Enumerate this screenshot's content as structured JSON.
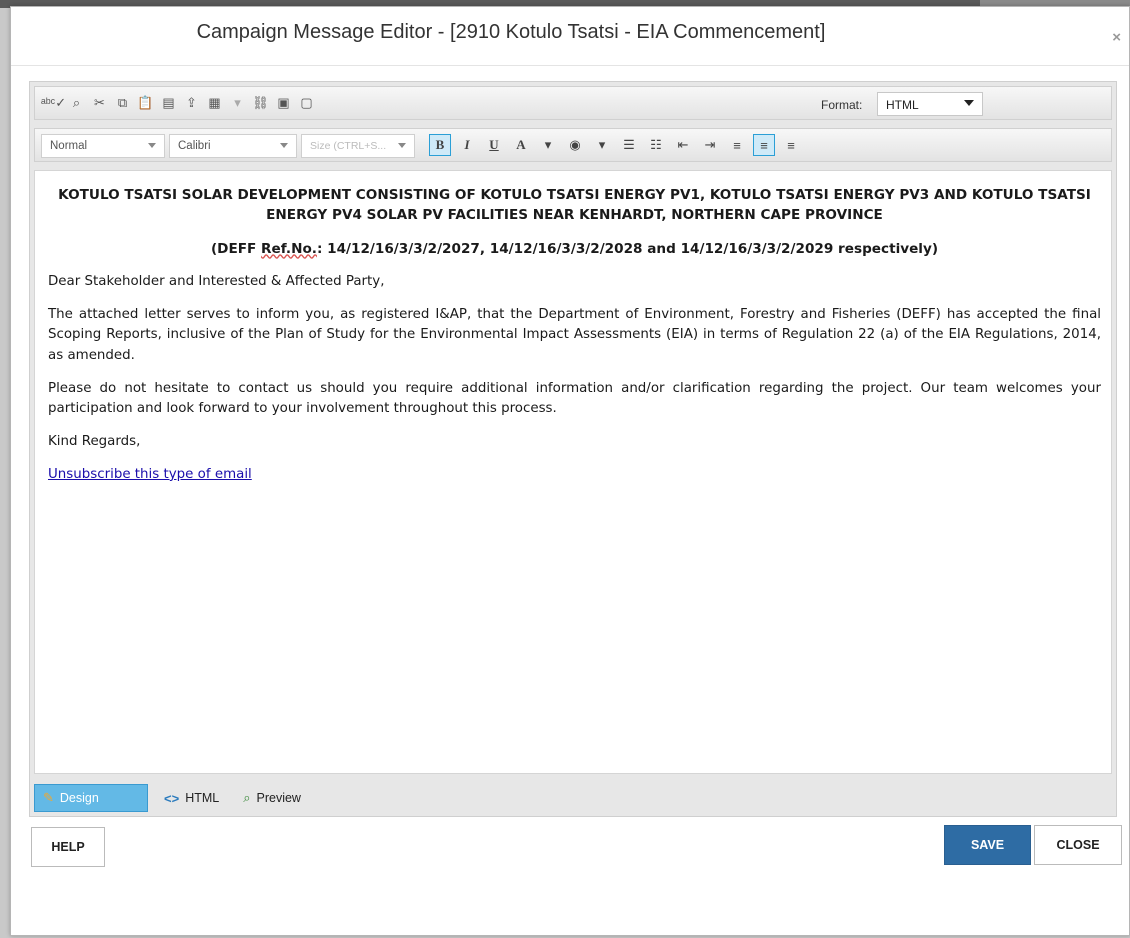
{
  "dialog": {
    "title": "Campaign Message Editor - [2910 Kotulo Tsatsi - EIA Commencement]",
    "close_glyph": "×"
  },
  "toolbar": {
    "row1_icons": [
      {
        "name": "spellcheck-icon",
        "glyph": "ᵃᵇᶜ✓"
      },
      {
        "name": "find-icon",
        "glyph": "⌕"
      },
      {
        "name": "cut-icon",
        "glyph": "✂"
      },
      {
        "name": "copy-icon",
        "glyph": "⧉"
      },
      {
        "name": "paste-icon",
        "glyph": "📋"
      },
      {
        "name": "paste-from-word-icon",
        "glyph": "▤"
      },
      {
        "name": "upload-icon",
        "glyph": "⇪"
      },
      {
        "name": "table-icon",
        "glyph": "▦"
      },
      {
        "name": "dropdown-arrow-icon",
        "glyph": "▾"
      },
      {
        "name": "link-icon",
        "glyph": "⛓"
      },
      {
        "name": "image-icon",
        "glyph": "▣"
      },
      {
        "name": "template-icon",
        "glyph": "▢"
      }
    ],
    "format_label": "Format:",
    "format_value": "HTML",
    "paragraph_style": "Normal",
    "font_family": "Calibri",
    "font_size_placeholder": "Size (CTRL+S...",
    "format_buttons": [
      {
        "name": "bold-button",
        "glyph": "B",
        "active": true,
        "serif": true
      },
      {
        "name": "italic-button",
        "glyph": "I",
        "active": false,
        "serif": true
      },
      {
        "name": "underline-button",
        "glyph": "U",
        "active": false,
        "serif": true
      },
      {
        "name": "font-color-button",
        "glyph": "A",
        "active": false,
        "serif": true
      },
      {
        "name": "font-color-dropdown-icon",
        "glyph": "▾",
        "active": false,
        "serif": false
      },
      {
        "name": "highlight-button",
        "glyph": "◉",
        "active": false,
        "serif": false
      },
      {
        "name": "highlight-dropdown-icon",
        "glyph": "▾",
        "active": false,
        "serif": false
      },
      {
        "name": "ordered-list-button",
        "glyph": "☰",
        "active": false,
        "serif": false
      },
      {
        "name": "bullet-list-button",
        "glyph": "☷",
        "active": false,
        "serif": false
      },
      {
        "name": "outdent-button",
        "glyph": "⇤",
        "active": false,
        "serif": false
      },
      {
        "name": "indent-button",
        "glyph": "⇥",
        "active": false,
        "serif": false
      },
      {
        "name": "align-left-button",
        "glyph": "≡",
        "active": false,
        "serif": false
      },
      {
        "name": "align-center-button",
        "glyph": "≡",
        "active": true,
        "serif": false
      },
      {
        "name": "align-right-button",
        "glyph": "≡",
        "active": false,
        "serif": false
      }
    ]
  },
  "content": {
    "heading": "KOTULO TSATSI SOLAR DEVELOPMENT CONSISTING OF KOTULO TSATSI ENERGY PV1, KOTULO TSATSI ENERGY PV3 AND KOTULO TSATSI ENERGY PV4 SOLAR PV FACILITIES NEAR KENHARDT, NORTHERN CAPE PROVINCE",
    "ref_prefix": "(DEFF ",
    "ref_misspelled": "Ref.No.",
    "ref_suffix": ": 14/12/16/3/3/2/2027, 14/12/16/3/3/2/2028 and 14/12/16/3/3/2/2029 respectively)",
    "greeting": "Dear Stakeholder and Interested & Affected Party,",
    "paragraph1": "The attached letter serves to inform you, as registered I&AP, that the Department of Environment, Forestry and Fisheries (DEFF) has accepted the final Scoping Reports, inclusive of the Plan of Study for the Environmental Impact Assessments (EIA) in terms of Regulation 22 (a) of the EIA Regulations, 2014, as amended.",
    "paragraph2": "Please do not hesitate to contact us should you require additional information and/or clarification regarding the project.  Our team welcomes your participation and look forward to your involvement throughout this process.",
    "closing": "Kind Regards,",
    "unsubscribe_link": "Unsubscribe this type of email"
  },
  "tabs": [
    {
      "label": "Design",
      "name": "tab-design",
      "icon": "✎",
      "icon_name": "pencil-icon",
      "active": true
    },
    {
      "label": "HTML",
      "name": "tab-html",
      "icon": "<>",
      "icon_name": "code-icon",
      "active": false
    },
    {
      "label": "Preview",
      "name": "tab-preview",
      "icon": "⌕",
      "icon_name": "magnifier-icon",
      "active": false
    }
  ],
  "buttons": {
    "help": "HELP",
    "save": "SAVE",
    "close": "CLOSE"
  },
  "colors": {
    "save_button": "#2e6ca4",
    "active_tab": "#63b9e6",
    "link": "#1a0dab"
  }
}
